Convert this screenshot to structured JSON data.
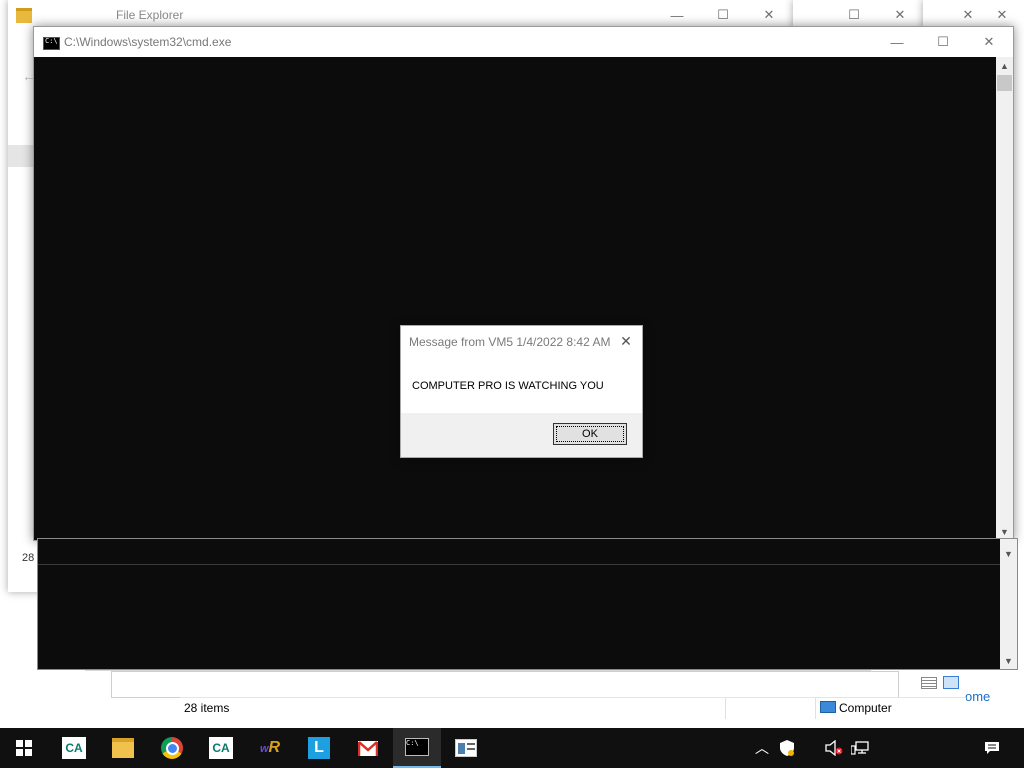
{
  "explorer_window": {
    "title": "File Explorer",
    "status_count": "28 items",
    "side_count": "28"
  },
  "computer_label": "Computer",
  "home_link": "ome",
  "cmd_window": {
    "title": "C:\\Windows\\system32\\cmd.exe"
  },
  "dialog": {
    "title": "Message from VM5 1/4/2022 8:42 AM",
    "message": "COMPUTER PRO IS WATCHING YOU",
    "ok_label": "OK"
  },
  "window_controls": {
    "minimize": "—",
    "maximize": "☐",
    "close": "✕"
  },
  "taskbar": {
    "items": [
      {
        "icon": "windows-start-icon"
      },
      {
        "icon": "credit-agricole-icon"
      },
      {
        "icon": "file-explorer-icon"
      },
      {
        "icon": "chrome-icon"
      },
      {
        "icon": "credit-agricole-icon"
      },
      {
        "icon": "winrar-icon"
      },
      {
        "icon": "l-app-icon"
      },
      {
        "icon": "gmail-icon"
      },
      {
        "icon": "cmd-icon"
      },
      {
        "icon": "app-window-icon"
      }
    ],
    "tray": [
      "chevron-up-icon",
      "security-shield-icon",
      "speaker-muted-icon",
      "network-icon",
      "notifications-icon"
    ]
  },
  "colors": {
    "taskbar": "#101010",
    "console": "#0c0c0c",
    "dialog_footer": "#f0f0f0"
  }
}
